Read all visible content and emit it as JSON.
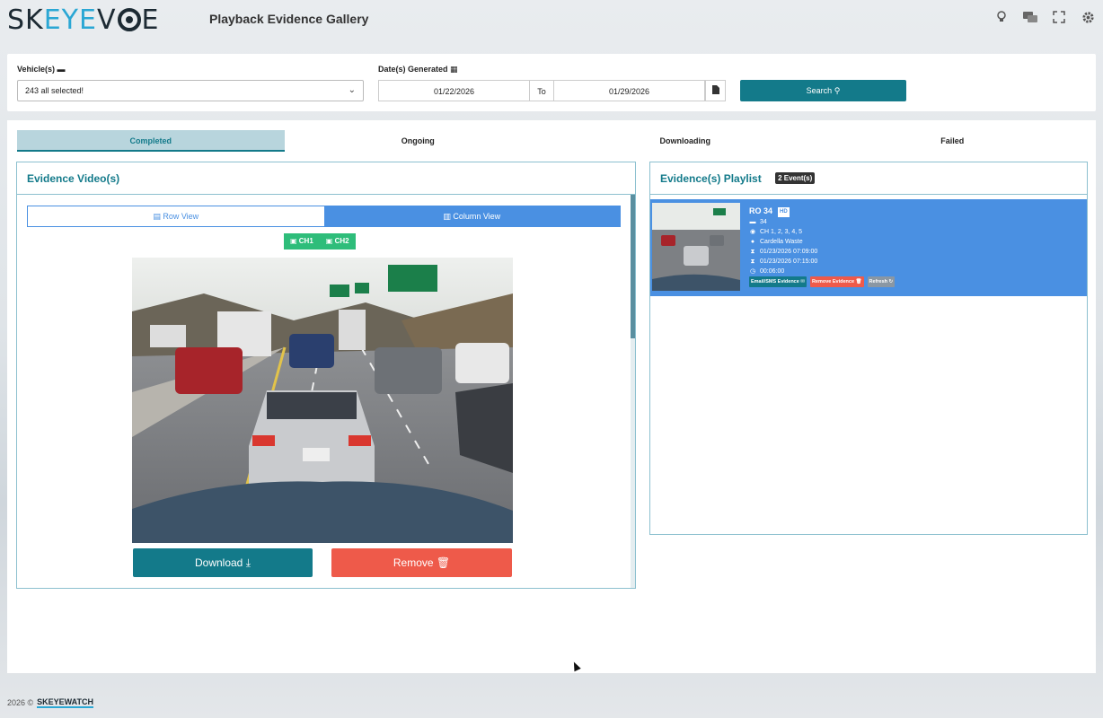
{
  "header": {
    "logo_left": "SK",
    "logo_blue": "EYE",
    "logo_right": "V",
    "logo_end": "E",
    "title": "Playback Evidence Gallery",
    "icons": [
      "lightbulb-icon",
      "chat-icon",
      "fullscreen-icon",
      "gear-icon"
    ]
  },
  "filters": {
    "vehicles_label": "Vehicle(s)",
    "vehicles_value": "243 all selected!",
    "dates_label": "Date(s) Generated",
    "date_from": "01/22/2026",
    "to_label": "To",
    "date_to": "01/29/2026",
    "search_label": "Search"
  },
  "tabs": [
    "Completed",
    "Ongoing",
    "Downloading",
    "Failed"
  ],
  "video_panel": {
    "title": "Evidence Video(s)",
    "row_view": "Row View",
    "column_view": "Column View",
    "ch1": "CH1",
    "ch2": "CH2",
    "download": "Download",
    "remove": "Remove"
  },
  "playlist": {
    "title": "Evidence(s) Playlist",
    "count_badge": "2 Event(s)",
    "item": {
      "title": "RO 34",
      "vehicle": "34",
      "channels": "CH 1, 2, 3, 4, 5",
      "driver": "Cardella Waste",
      "start": "01/23/2026 07:09:00",
      "end": "01/23/2026 07:15:00",
      "duration": "00:06:00",
      "email_btn": "Email/SMS Evidence",
      "remove_btn": "Remove Evidence",
      "refresh_btn": "Refresh"
    }
  },
  "footer": {
    "copyright": "2026 ©",
    "brand": "SKEYEWATCH"
  },
  "colors": {
    "accent_teal": "#137a8a",
    "accent_blue": "#4a90e2",
    "danger": "#ee5a4a",
    "success": "#2ebd7a"
  }
}
